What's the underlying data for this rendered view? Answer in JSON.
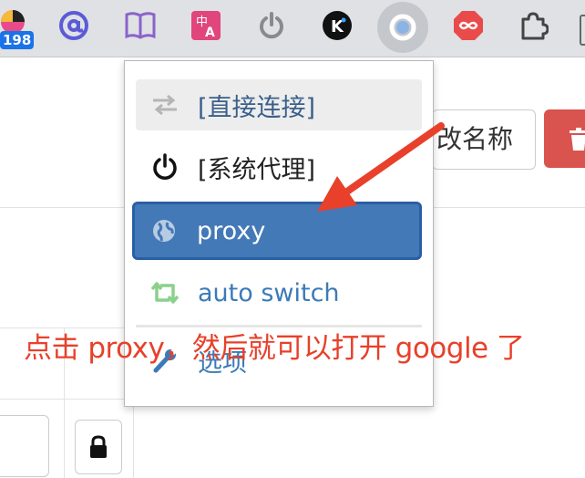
{
  "toolbar": {
    "badge_count": "198",
    "extensions": [
      "colorful-extension-icon",
      "at-sign-icon",
      "book-icon",
      "translate-icon",
      "power-icon",
      "k-logo-icon",
      "circle-proxy-icon",
      "infinity-icon",
      "puzzle-icon"
    ]
  },
  "page": {
    "rename_label": "改名称",
    "delete_color": "#d9534f"
  },
  "popup": {
    "items": [
      {
        "label": "[直接连接]",
        "icon": "swap-arrows-icon"
      },
      {
        "label": "[系统代理]",
        "icon": "power-icon"
      },
      {
        "label": "proxy",
        "icon": "globe-icon"
      },
      {
        "label": "auto switch",
        "icon": "retweet-icon"
      },
      {
        "label": "选项",
        "icon": "wrench-icon"
      }
    ],
    "selected": "proxy",
    "selected_color": "#4379b6"
  },
  "annotation": {
    "text": "点击 proxy，然后就可以打开 google 了",
    "color": "#e8402a"
  }
}
